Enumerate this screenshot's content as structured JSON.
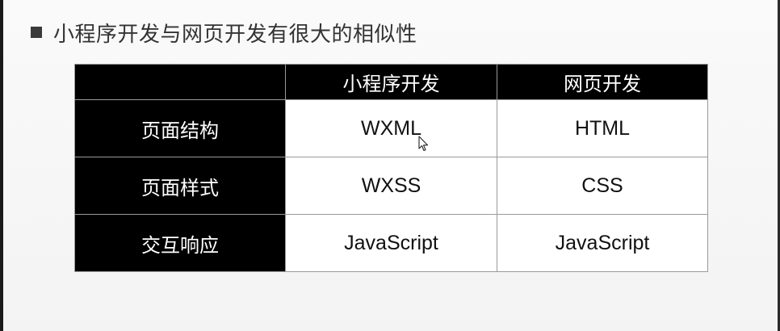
{
  "slide": {
    "heading": "小程序开发与网页开发有很大的相似性"
  },
  "table": {
    "header": [
      "",
      "小程序开发",
      "网页开发"
    ],
    "rows": [
      {
        "label": "页面结构",
        "miniprogram": "WXML",
        "web": "HTML"
      },
      {
        "label": "页面样式",
        "miniprogram": "WXSS",
        "web": "CSS"
      },
      {
        "label": "交互响应",
        "miniprogram": "JavaScript",
        "web": "JavaScript"
      }
    ]
  },
  "icons": {
    "bullet": "square-bullet-icon",
    "cursor": "mouse-pointer-icon"
  },
  "colors": {
    "header_bg": "#000000",
    "header_text": "#ffffff",
    "cell_bg": "#ffffff",
    "cell_text": "#111111",
    "heading_text": "#333333"
  }
}
